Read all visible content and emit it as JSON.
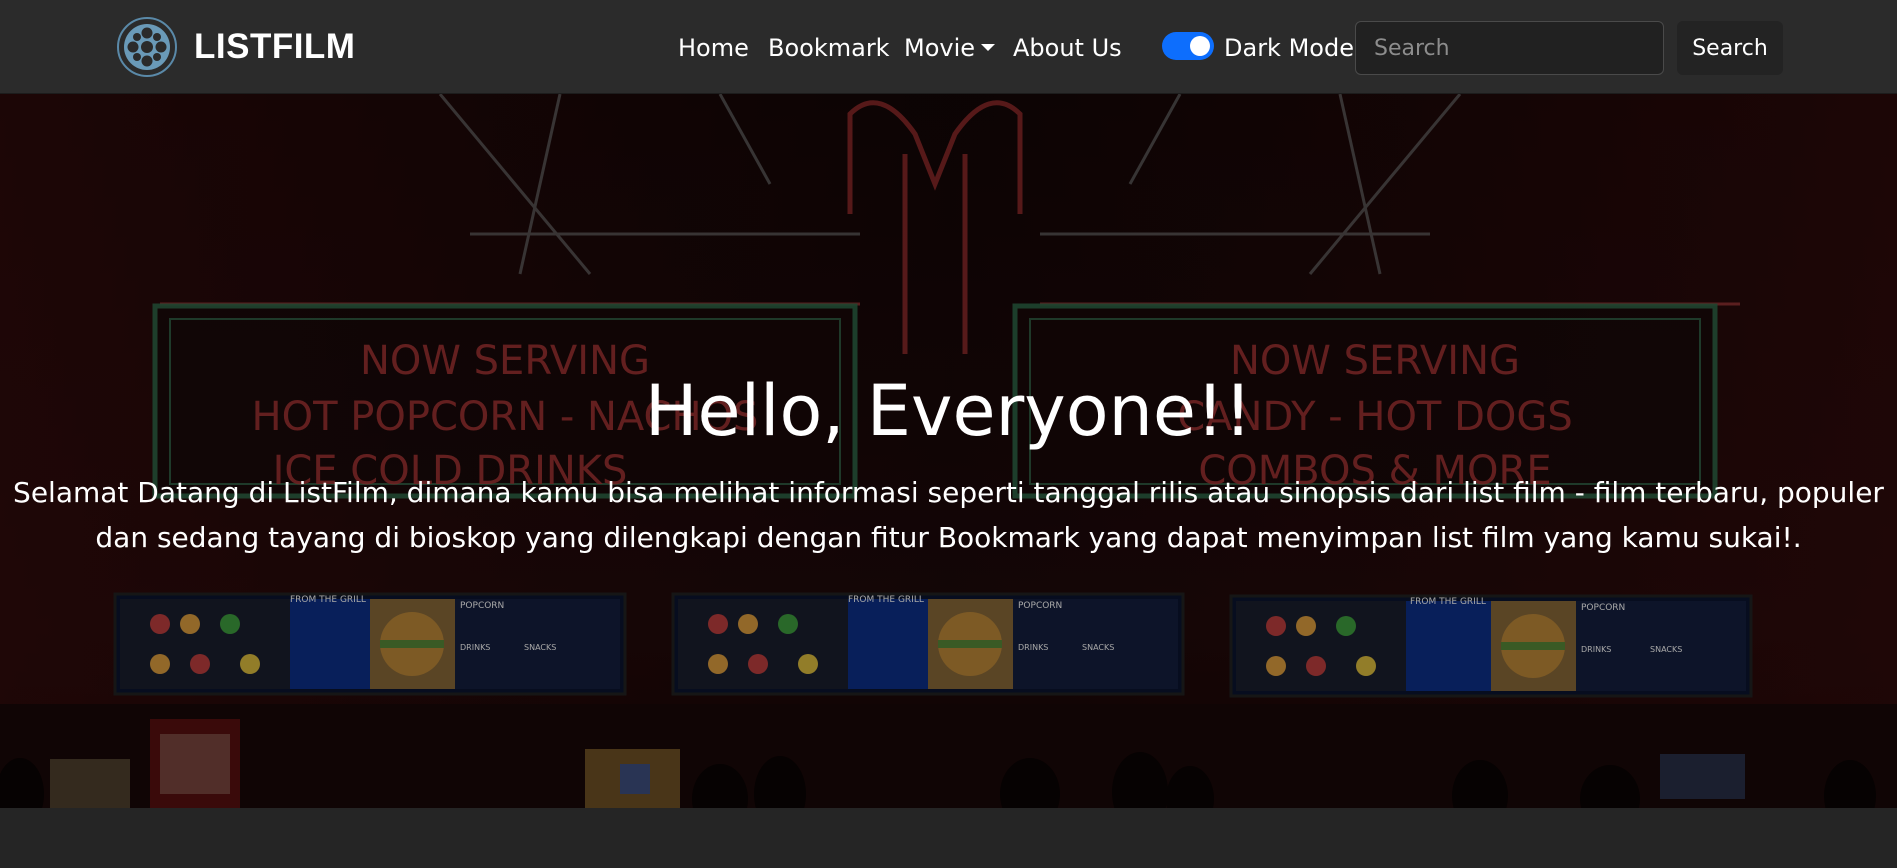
{
  "brand": {
    "name": "LISTFILM",
    "logo_icon": "film-reel-icon"
  },
  "nav": {
    "home": "Home",
    "bookmark": "Bookmark",
    "movie": "Movie",
    "about": "About Us"
  },
  "dark_mode": {
    "label": "Dark Mode",
    "enabled": true
  },
  "search": {
    "placeholder": "Search",
    "value": "",
    "button_label": "Search"
  },
  "hero": {
    "title": "Hello, Everyone!!",
    "text_line1": "Selamat Datang di ListFilm, dimana kamu bisa melihat informasi seperti tanggal rilis atau sinopsis dari list film - film terbaru, populer",
    "text_line2": "dan sedang tayang di bioskop yang dilengkapi dengan fitur Bookmark yang dapat menyimpan list film yang kamu sukai!.",
    "sign_left": {
      "line1": "NOW SERVING",
      "line2": "HOT POPCORN - NACHOS",
      "line3": "ICE COLD DRINKS"
    },
    "sign_right": {
      "line1": "NOW SERVING",
      "line2": "CANDY - HOT DOGS",
      "line3": "COMBOS & MORE"
    },
    "menu_board": {
      "grill": "FROM THE GRILL",
      "popcorn": "POPCORN",
      "drinks": "DRINKS",
      "snacks": "SNACKS"
    }
  },
  "colors": {
    "navbar": "#2b2b2b",
    "toggle_accent": "#0d6efd",
    "page_bg": "#252525"
  }
}
